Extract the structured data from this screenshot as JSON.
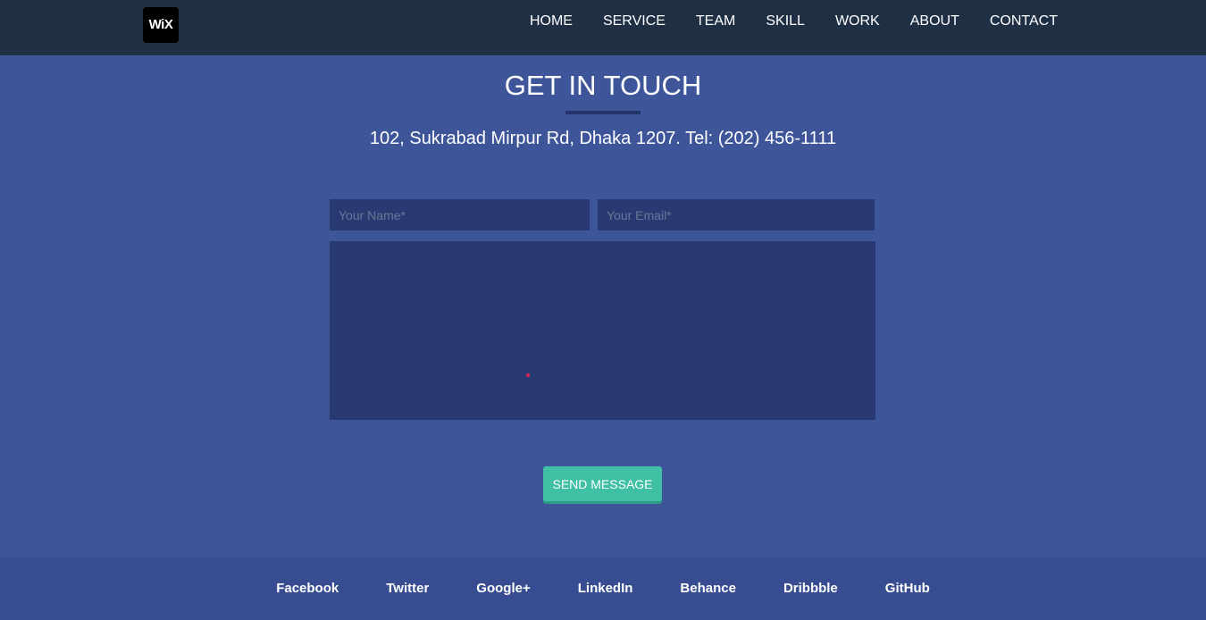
{
  "header": {
    "logo_text": "WiX",
    "nav": [
      "HOME",
      "SERVICE",
      "TEAM",
      "SKILL",
      "WORK",
      "ABOUT",
      "CONTACT"
    ]
  },
  "contact": {
    "title": "GET IN TOUCH",
    "address": "102, Sukrabad Mirpur Rd, Dhaka 1207. Tel: (202) 456-1111",
    "form": {
      "name_placeholder": "Your Name*",
      "email_placeholder": "Your Email*",
      "name_value": "",
      "email_value": "",
      "message_value": "",
      "submit_label": "SEND MESSAGE"
    }
  },
  "footer": {
    "links": [
      "Facebook",
      "Twitter",
      "Google+",
      "LinkedIn",
      "Behance",
      "Dribbble",
      "GitHub"
    ]
  },
  "colors": {
    "page_bg": "#3e5599",
    "navbar_bg": "#1f2f44",
    "field_bg": "#293a72",
    "button_bg": "#3fbfa3",
    "footer_bg": "#384d91"
  }
}
